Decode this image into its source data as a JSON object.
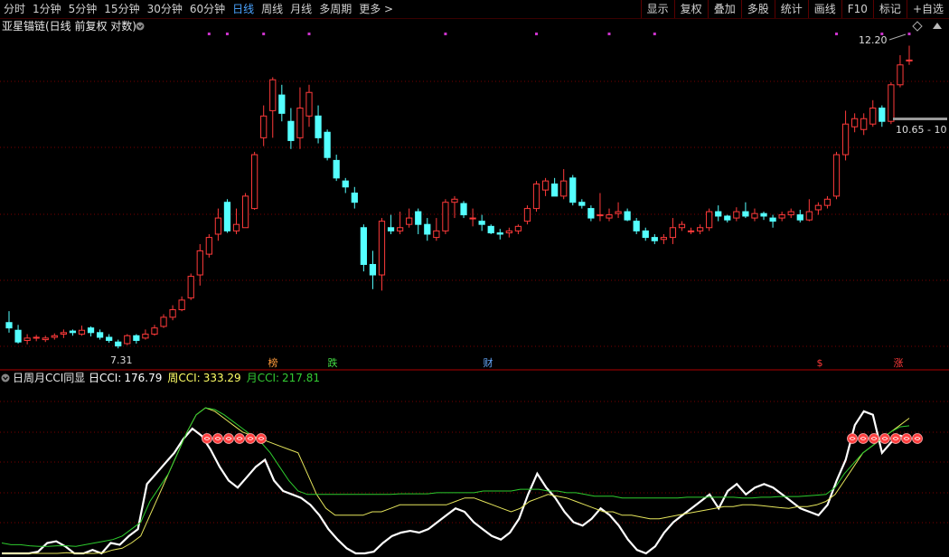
{
  "toolbar": {
    "periods": [
      "分时",
      "1分钟",
      "5分钟",
      "15分钟",
      "30分钟",
      "60分钟",
      "日线",
      "周线",
      "月线",
      "多周期",
      "更多 >"
    ],
    "active_period": "日线",
    "actions": [
      "显示",
      "复权",
      "叠加",
      "多股",
      "统计",
      "画线",
      "F10",
      "标记",
      "+自选"
    ]
  },
  "main_panel": {
    "title": "亚星锚链(日线 前复权 对数)",
    "high_label": "12.20",
    "low_label": "7.31",
    "price_box": "10.65 - 10",
    "event_markers": [
      "榜",
      "跌",
      "财",
      "$",
      "涨"
    ]
  },
  "indicator_panel": {
    "name": "日周月CCI同显",
    "legend": [
      {
        "label": "日CCI:",
        "value": "176.79",
        "color": "#ffffff"
      },
      {
        "label": "周CCI:",
        "value": "333.29",
        "color": "#ffff66"
      },
      {
        "label": "月CCI:",
        "value": "217.81",
        "color": "#33cc33"
      }
    ]
  },
  "colors": {
    "up": "#ff3a3a",
    "down": "#54ffff",
    "grid": "#7a0000",
    "day_cci": "#ffffff",
    "week_cci": "#e6e65c",
    "month_cci": "#2ecc2e",
    "marker": "#ff4040",
    "dot": "#cc33cc"
  },
  "chart_data": [
    {
      "type": "candlestick",
      "title": "亚星锚链(日线 前复权 对数)",
      "scale": "log",
      "ylim": [
        7.0,
        12.5
      ],
      "annotations": [
        "12.20",
        "7.31"
      ],
      "candles": [
        [
          7.55,
          7.48,
          7.7,
          7.42
        ],
        [
          7.45,
          7.3,
          7.52,
          7.28
        ],
        [
          7.32,
          7.35,
          7.4,
          7.27
        ],
        [
          7.35,
          7.36,
          7.39,
          7.31
        ],
        [
          7.33,
          7.35,
          7.38,
          7.3
        ],
        [
          7.36,
          7.38,
          7.41,
          7.33
        ],
        [
          7.4,
          7.42,
          7.46,
          7.35
        ],
        [
          7.44,
          7.42,
          7.46,
          7.38
        ],
        [
          7.4,
          7.45,
          7.51,
          7.38
        ],
        [
          7.48,
          7.42,
          7.5,
          7.37
        ],
        [
          7.42,
          7.36,
          7.46,
          7.33
        ],
        [
          7.36,
          7.32,
          7.4,
          7.29
        ],
        [
          7.3,
          7.25,
          7.33,
          7.22
        ],
        [
          7.28,
          7.38,
          7.4,
          7.26
        ],
        [
          7.38,
          7.32,
          7.4,
          7.28
        ],
        [
          7.35,
          7.4,
          7.46,
          7.33
        ],
        [
          7.4,
          7.48,
          7.52,
          7.38
        ],
        [
          7.5,
          7.62,
          7.66,
          7.48
        ],
        [
          7.62,
          7.72,
          7.78,
          7.58
        ],
        [
          7.72,
          7.85,
          7.9,
          7.7
        ],
        [
          7.88,
          8.18,
          8.22,
          7.85
        ],
        [
          8.2,
          8.55,
          8.65,
          8.05
        ],
        [
          8.5,
          8.75,
          8.8,
          8.45
        ],
        [
          8.8,
          9.05,
          9.2,
          8.7
        ],
        [
          9.3,
          8.85,
          9.35,
          8.82
        ],
        [
          8.85,
          8.95,
          9.2,
          8.8
        ],
        [
          8.9,
          9.4,
          9.45,
          8.9
        ],
        [
          9.2,
          10.1,
          10.15,
          9.18
        ],
        [
          10.4,
          10.8,
          11.0,
          10.25
        ],
        [
          10.9,
          11.5,
          11.55,
          10.4
        ],
        [
          11.2,
          10.85,
          11.4,
          10.7
        ],
        [
          10.7,
          10.35,
          10.95,
          10.2
        ],
        [
          10.4,
          10.95,
          11.35,
          10.2
        ],
        [
          10.8,
          11.25,
          11.4,
          10.6
        ],
        [
          10.8,
          10.4,
          11.0,
          10.3
        ],
        [
          10.5,
          10.05,
          10.55,
          10.0
        ],
        [
          10.0,
          9.7,
          10.1,
          9.65
        ],
        [
          9.65,
          9.55,
          9.7,
          9.45
        ],
        [
          9.45,
          9.3,
          9.55,
          9.2
        ],
        [
          8.9,
          8.35,
          8.95,
          8.25
        ],
        [
          8.35,
          8.2,
          8.55,
          8.0
        ],
        [
          8.2,
          9.0,
          9.05,
          7.98
        ],
        [
          8.9,
          8.85,
          9.1,
          8.8
        ],
        [
          8.85,
          8.9,
          9.15,
          8.8
        ],
        [
          8.95,
          9.05,
          9.2,
          8.9
        ],
        [
          9.15,
          8.95,
          9.2,
          8.8
        ],
        [
          8.95,
          8.8,
          9.05,
          8.7
        ],
        [
          8.75,
          8.85,
          9.05,
          8.7
        ],
        [
          8.85,
          9.3,
          9.35,
          8.8
        ],
        [
          9.3,
          9.35,
          9.4,
          9.05
        ],
        [
          9.28,
          9.1,
          9.32,
          9.05
        ],
        [
          9.05,
          9.05,
          9.2,
          8.92
        ],
        [
          9.0,
          8.95,
          9.1,
          8.85
        ],
        [
          8.92,
          8.82,
          8.95,
          8.8
        ],
        [
          8.82,
          8.8,
          8.88,
          8.72
        ],
        [
          8.82,
          8.85,
          8.9,
          8.75
        ],
        [
          8.85,
          8.92,
          8.95,
          8.8
        ],
        [
          9.0,
          9.2,
          9.25,
          8.95
        ],
        [
          9.2,
          9.6,
          9.65,
          9.15
        ],
        [
          9.5,
          9.65,
          9.7,
          9.4
        ],
        [
          9.6,
          9.4,
          9.7,
          9.4
        ],
        [
          9.4,
          9.65,
          9.85,
          9.35
        ],
        [
          9.7,
          9.3,
          9.75,
          9.25
        ],
        [
          9.3,
          9.25,
          9.35,
          9.2
        ],
        [
          9.2,
          9.05,
          9.25,
          9.0
        ],
        [
          9.1,
          9.1,
          9.45,
          9.0
        ],
        [
          9.05,
          9.1,
          9.2,
          9.0
        ],
        [
          9.12,
          9.15,
          9.3,
          9.05
        ],
        [
          9.15,
          9.02,
          9.2,
          9.0
        ],
        [
          9.0,
          8.85,
          9.05,
          8.8
        ],
        [
          8.85,
          8.75,
          8.9,
          8.7
        ],
        [
          8.75,
          8.7,
          8.8,
          8.65
        ],
        [
          8.72,
          8.75,
          8.8,
          8.65
        ],
        [
          8.75,
          8.9,
          9.05,
          8.65
        ],
        [
          8.9,
          8.95,
          9.0,
          8.85
        ],
        [
          8.85,
          8.85,
          8.9,
          8.8
        ],
        [
          8.85,
          8.9,
          8.95,
          8.8
        ],
        [
          8.9,
          9.15,
          9.2,
          8.85
        ],
        [
          9.15,
          9.08,
          9.25,
          9.0
        ],
        [
          9.08,
          9.02,
          9.1,
          8.98
        ],
        [
          9.05,
          9.15,
          9.22,
          9.0
        ],
        [
          9.15,
          9.08,
          9.3,
          9.05
        ],
        [
          9.05,
          9.12,
          9.2,
          9.0
        ],
        [
          9.12,
          9.08,
          9.15,
          9.02
        ],
        [
          9.05,
          9.0,
          9.1,
          8.9
        ],
        [
          9.05,
          9.1,
          9.15,
          9.0
        ],
        [
          9.1,
          9.15,
          9.2,
          9.05
        ],
        [
          9.1,
          9.02,
          9.18,
          8.98
        ],
        [
          9.02,
          9.15,
          9.35,
          9.0
        ],
        [
          9.18,
          9.25,
          9.3,
          9.1
        ],
        [
          9.25,
          9.35,
          9.4,
          9.2
        ],
        [
          9.4,
          10.1,
          10.15,
          9.35
        ],
        [
          10.1,
          10.65,
          10.9,
          10.0
        ],
        [
          10.6,
          10.75,
          10.85,
          10.5
        ],
        [
          10.55,
          10.75,
          10.85,
          10.45
        ],
        [
          10.65,
          10.95,
          11.1,
          10.6
        ],
        [
          10.95,
          10.7,
          11.0,
          10.6
        ],
        [
          10.7,
          11.4,
          11.45,
          10.65
        ],
        [
          11.4,
          11.8,
          12.0,
          11.35
        ],
        [
          11.9,
          11.9,
          12.2,
          11.8
        ]
      ],
      "dots_above": 11
    },
    {
      "type": "line",
      "title": "日周月CCI同显",
      "ylim": [
        -150,
        330
      ],
      "series": [
        {
          "name": "日CCI",
          "values": [
            -250,
            -215,
            -200,
            -170,
            -145,
            -120,
            -115,
            -130,
            -150,
            -160,
            -140,
            -150,
            -120,
            -125,
            -100,
            -80,
            50,
            80,
            110,
            140,
            180,
            210,
            190,
            150,
            100,
            60,
            40,
            70,
            100,
            120,
            60,
            30,
            20,
            10,
            -10,
            -40,
            -80,
            -110,
            -135,
            -150,
            -160,
            -145,
            -120,
            -100,
            -90,
            -85,
            -90,
            -80,
            -60,
            -40,
            -20,
            -30,
            -60,
            -80,
            -100,
            -110,
            -90,
            -50,
            20,
            80,
            40,
            10,
            -30,
            -60,
            -70,
            -50,
            -20,
            -40,
            -70,
            -110,
            -140,
            -150,
            -130,
            -90,
            -60,
            -40,
            -20,
            0,
            20,
            -20,
            30,
            50,
            20,
            40,
            50,
            40,
            20,
            0,
            -20,
            -30,
            -40,
            -10,
            60,
            120,
            220,
            260,
            250,
            140,
            170,
            190,
            180
          ]
        },
        {
          "name": "周CCI",
          "values": [
            -170,
            -165,
            -160,
            -158,
            -160,
            -150,
            -150,
            -148,
            -152,
            -150,
            -150,
            -148,
            -140,
            -135,
            -120,
            -100,
            -40,
            20,
            80,
            140,
            200,
            250,
            270,
            260,
            240,
            220,
            200,
            190,
            180,
            170,
            160,
            150,
            140,
            80,
            20,
            -20,
            -40,
            -40,
            -40,
            -40,
            -30,
            -30,
            -20,
            -10,
            -10,
            -10,
            -10,
            -10,
            -10,
            0,
            10,
            10,
            0,
            -10,
            -20,
            -30,
            -20,
            0,
            10,
            20,
            15,
            10,
            0,
            -10,
            -20,
            -30,
            -30,
            -40,
            -40,
            -45,
            -50,
            -50,
            -45,
            -40,
            -35,
            -30,
            -25,
            -20,
            -15,
            -15,
            -10,
            -10,
            -12,
            -15,
            -18,
            -20,
            -15,
            -15,
            -10,
            0,
            20,
            60,
            100,
            140,
            160,
            180,
            200,
            220,
            240
          ]
        },
        {
          "name": "月CCI",
          "values": [
            -120,
            -125,
            -125,
            -128,
            -130,
            -130,
            -128,
            -128,
            -130,
            -125,
            -120,
            -115,
            -110,
            -100,
            -80,
            -60,
            0,
            40,
            80,
            140,
            200,
            250,
            270,
            265,
            250,
            230,
            210,
            190,
            170,
            140,
            100,
            60,
            30,
            20,
            20,
            20,
            20,
            20,
            20,
            20,
            20,
            20,
            20,
            22,
            22,
            22,
            22,
            25,
            25,
            25,
            25,
            25,
            30,
            30,
            30,
            30,
            35,
            35,
            35,
            30,
            30,
            25,
            25,
            20,
            15,
            15,
            15,
            10,
            10,
            10,
            10,
            10,
            10,
            10,
            12,
            12,
            12,
            12,
            12,
            12,
            10,
            10,
            12,
            12,
            14,
            14,
            14,
            16,
            18,
            20,
            40,
            80,
            110,
            140,
            160,
            180,
            200,
            215,
            218
          ]
        }
      ]
    }
  ]
}
